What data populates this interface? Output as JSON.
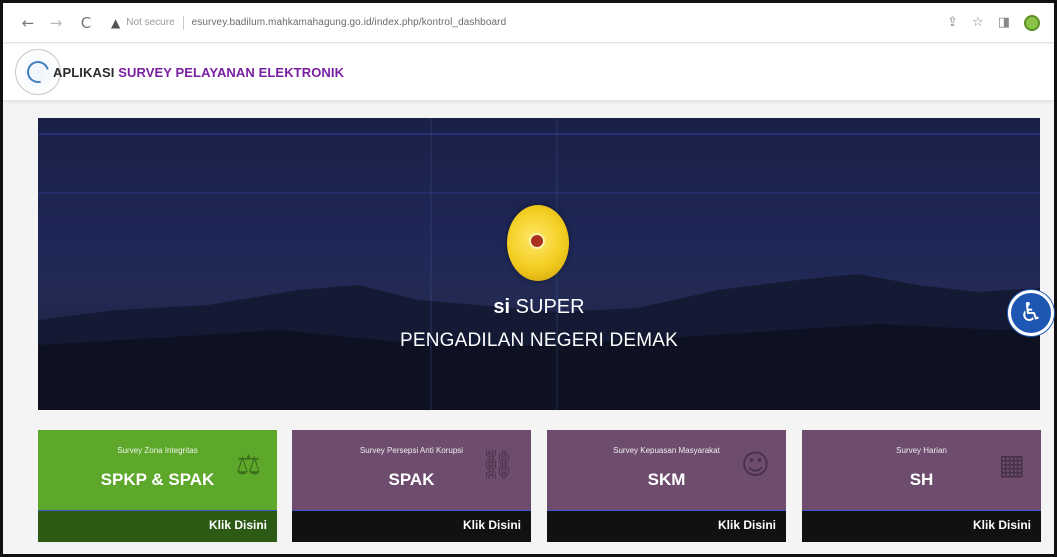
{
  "browser": {
    "back_icon": "←",
    "forward_icon": "→",
    "reload_icon": "C",
    "warning_icon": "▲",
    "not_secure": "Not secure",
    "url": "esurvey.badilum.mahkamahagung.go.id/index.php/kontrol_dashboard",
    "icons": [
      "share-icon",
      "star-icon",
      "sidepanel-icon",
      "profile-avatar"
    ]
  },
  "header": {
    "title_prefix": "APLIKASI ",
    "title_accent": "SURVEY PELAYANAN ELEKTRONIK",
    "accent_color": "#7a1fa2"
  },
  "hero": {
    "title_bold": "si",
    "title_rest": " SUPER",
    "subtitle": "PENGADILAN NEGERI DEMAK"
  },
  "cards": [
    {
      "subtitle": "Survey Zona Integritas",
      "title": "SPKP & SPAK",
      "link": "Klik Disini",
      "color": "#5da72a"
    },
    {
      "subtitle": "Survey Persepsi Anti Korupsi",
      "title": "SPAK",
      "link": "Klik Disini",
      "color": "#6d4c6d"
    },
    {
      "subtitle": "Survey Kepuasan Masyarakat",
      "title": "SKM",
      "link": "Klik Disini",
      "color": "#6d4c6d"
    },
    {
      "subtitle": "Survey Harian",
      "title": "SH",
      "link": "Klik Disini",
      "color": "#6d4c6d"
    }
  ]
}
